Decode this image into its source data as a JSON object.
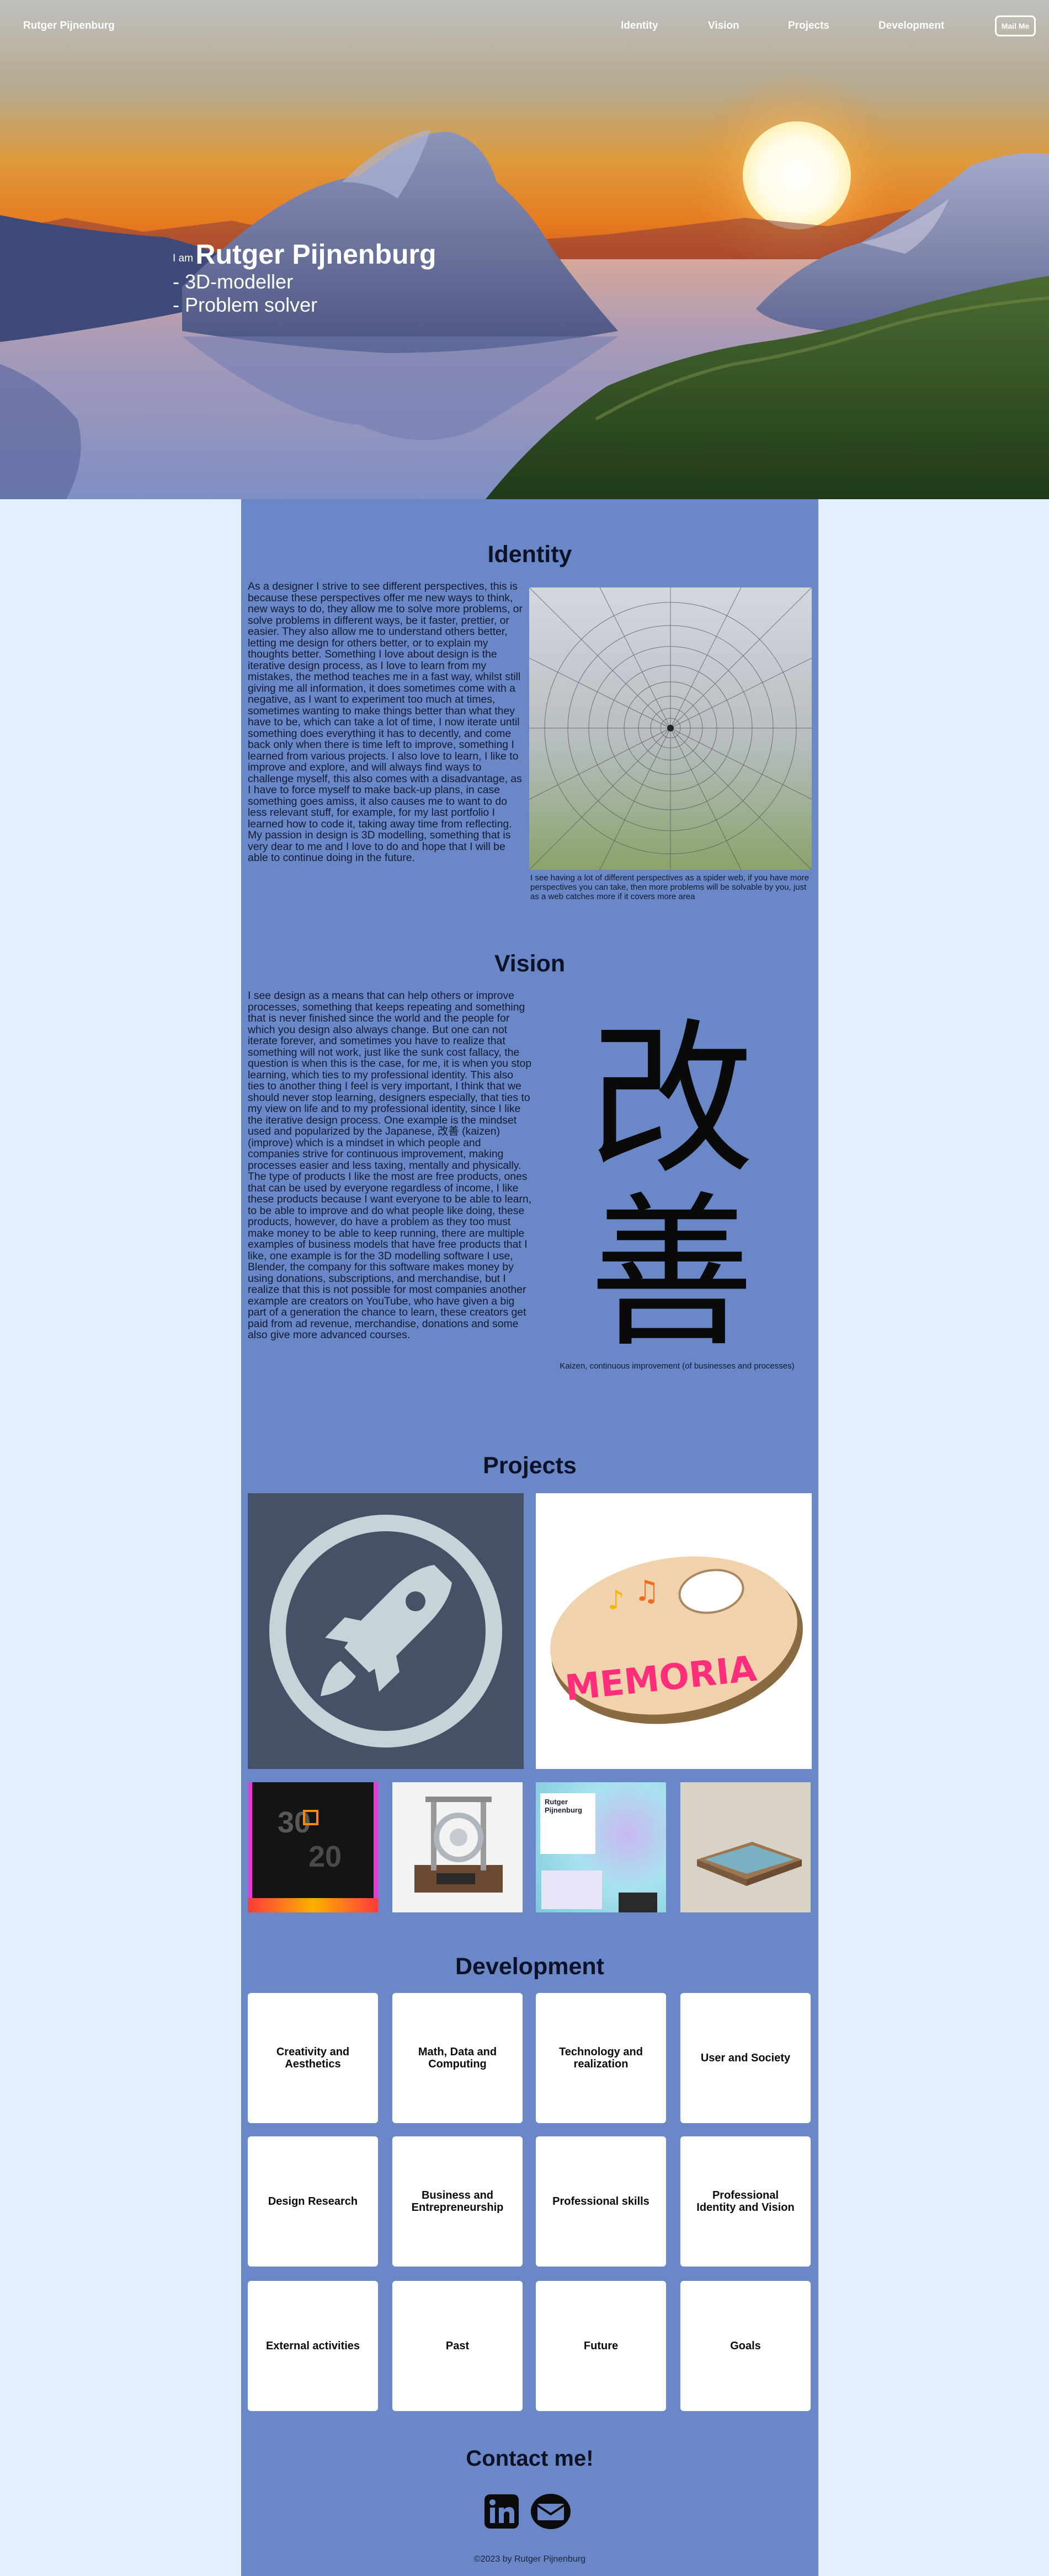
{
  "nav": {
    "brand": "Rutger Pijnenburg",
    "links": [
      "Identity",
      "Vision",
      "Projects",
      "Development"
    ],
    "mail_button": "Mail Me"
  },
  "hero": {
    "prefix": "I am",
    "name": "Rutger Pijnenburg",
    "roles": [
      "- 3D-modeller",
      "- Problem solver"
    ]
  },
  "identity": {
    "title": "Identity",
    "text": "As a designer I strive to see different perspectives, this is because these perspectives offer me new ways to think, new ways to do, they allow me to solve more problems, or solve problems in different ways, be it faster, prettier, or easier. They also allow me to understand others better, letting me design for others better, or to explain my thoughts better. Something I love about design is the iterative design process, as I love to learn from my mistakes, the method teaches me in a fast way, whilst still giving me all information, it does sometimes come with a negative, as I want to experiment too much at times, sometimes wanting to make things better than what they have to be, which can take a lot of time, I now iterate until something does everything it has to decently, and come back only when there is time left to improve, something I learned from various projects. I also love to learn, I like to improve and explore, and will always find ways to challenge myself, this also comes with a disadvantage, as I have to force myself to make back-up plans, in case something goes amiss, it also causes me to want to do less relevant stuff, for example, for my last portfolio I learned how to code it, taking away time from reflecting. My passion in design is 3D modelling, something that is very dear to me and I love to do and hope that I will be able to continue doing in the future.",
    "caption": "I see having a lot of different perspectives as a spider web, if you have more perspectives you can take, then more problems will be solvable by you, just as a web catches more if it covers more area"
  },
  "vision": {
    "title": "Vision",
    "text": "I see design as a means that can help others or improve processes, something that keeps repeating and something that is never finished since the world and the people for which you design also always change. But one can not iterate forever, and sometimes you have to realize that something will not work, just like the sunk cost fallacy, the question is when this is the case, for me, it is when you stop learning, which ties to my professional identity. This also ties to another thing I feel is very important, I think that we should never stop learning, designers especially, that ties to my view on life and to my professional identity, since I like the iterative design process. One example is the mindset used and popularized by the Japanese, 改善 (kaizen) (improve) which is a mindset in which people and companies strive for continuous improvement, making processes easier and less taxing, mentally and physically. The type of products I like the most are free products, ones that can be used by everyone regardless of income, I like these products because I want everyone to be able to learn, to be able to improve and do what people like doing, these products, however, do have a problem as they too must make money to be able to keep running, there are multiple examples of business models that have free products that I like, one example is for the 3D modelling software I use, Blender, the company for this software makes money by using donations, subscriptions, and merchandise, but I realize that this is not possible for most companies another example are creators on YouTube, who have given a big part of a generation the chance to learn, these creators get paid from ad revenue, merchandise, donations and some also give more advanced courses.",
    "kanji": [
      "改",
      "善"
    ],
    "caption": "Kaizen, continuous improvement (of businesses and processes)"
  },
  "projects": {
    "title": "Projects",
    "memoria_text": "MEMORIA",
    "screen_title": "Rutger Pijnenburg",
    "timer_text": [
      "30",
      "20"
    ]
  },
  "development": {
    "title": "Development",
    "tiles": [
      "Creativity and Aesthetics",
      "Math, Data and Computing",
      "Technology and realization",
      "User and Society",
      "Design Research",
      "Business and Entrepreneurship",
      "Professional skills",
      "Professional Identity and Vision",
      "External activities",
      "Past",
      "Future",
      "Goals"
    ]
  },
  "contact": {
    "title": "Contact me!",
    "icons": [
      "linkedin-icon",
      "mail-icon"
    ]
  },
  "footer": {
    "text": "©2023 by Rutger Pijnenburg"
  },
  "colors": {
    "page_bg": "#e2effd",
    "column_bg": "#6a88c7",
    "text_dark": "#0d1226",
    "rocket_bg": "#445166"
  }
}
